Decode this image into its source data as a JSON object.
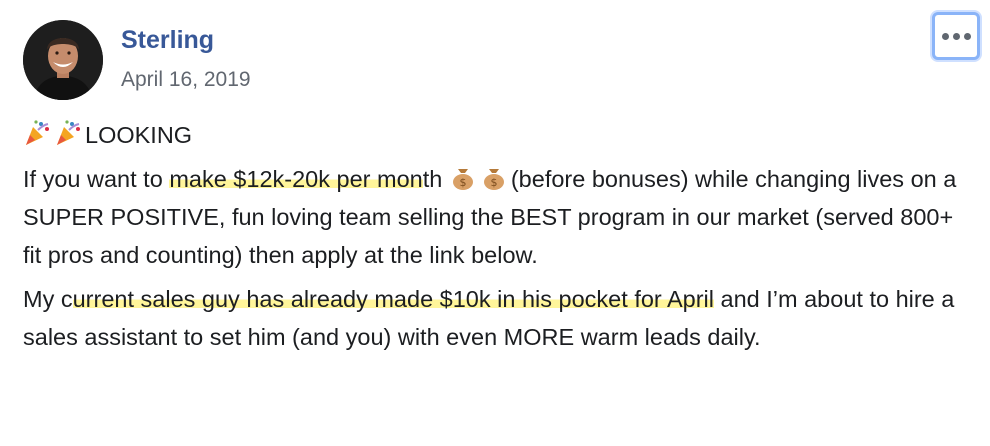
{
  "author": {
    "name": "Sterling",
    "date": "April 16, 2019",
    "avatar_icon": "profile-photo-icon"
  },
  "menu": {
    "more_icon": "more-options-icon",
    "more_label": "More options"
  },
  "post": {
    "headline_emoji_icon": "party-popper-icon",
    "headline": "LOOKING",
    "p1_prefix": "If you want to ",
    "p1_highlight": "make $12k-20k per mon",
    "p1_after_highlight": "th ",
    "money_icon": "money-bag-icon",
    "p1_suffix": "(before bonuses) while changing lives on a SUPER POSITIVE, fun loving team selling the BEST program in our market (served 800+ fit pros and counting) then apply at the link below.",
    "p2_prefix": "My c",
    "p2_highlight": "urrent sales guy has already made $10k in his pocket for April",
    "p2_suffix": " and I’m about to hire a sales assistant to set him (and you) with even MORE warm leads daily."
  },
  "colors": {
    "author_link": "#385898",
    "date_text": "#616770",
    "highlight": "#fff59a",
    "focus_ring": "#8ab4f8"
  }
}
